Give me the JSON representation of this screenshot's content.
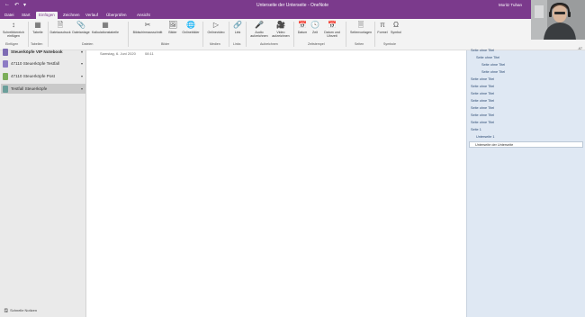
{
  "titlebar": {
    "title": "Unterseite der Unterseite  -  OneNote",
    "user": "Moritz Tuhan",
    "color": "#7b3a8c"
  },
  "menu": [
    "Datei",
    "Start",
    "Einfügen",
    "Zeichnen",
    "Verlauf",
    "Überprüfen",
    "Ansicht"
  ],
  "menu_active": "Einfügen",
  "ribbon": {
    "buttons": {
      "space": "Schreibbereich einfügen",
      "table": "Tabelle",
      "printout": "Dateiausdruck",
      "attachment": "Dateianlage",
      "spreadsheet": "Kalkulationstabelle",
      "screenshot": "Bildschirmausschnitt",
      "pictures": "Bilder",
      "online_pictures": "Onlinebilder",
      "online_video": "Onlinevideo",
      "link": "Link",
      "audio": "Audio aufzeichnen",
      "video": "Video aufzeichnen",
      "date": "Datum",
      "time": "Zeit",
      "datetime": "Datum und Uhrzeit",
      "page_templates": "Seitenvorlagen",
      "formula": "Formel",
      "symbol": "Symbol"
    },
    "groups": {
      "insert": "Einfügen",
      "tables": "Tabellen",
      "files": "Dateien",
      "images": "Bilder",
      "media": "Medien",
      "links": "Links",
      "recording": "Aufzeichnen",
      "timestamp": "Zeitstempel",
      "pages": "Seiten",
      "symbols": "Symbole"
    }
  },
  "notebooks": [
    {
      "label": "Steuerköpfe VIP Notebook",
      "color": "#7d6bb3"
    },
    {
      "label": "47110 Steuerköpfe Testfall",
      "color": "#8d7bc4"
    },
    {
      "label": "47110 Steuerköpfe Post",
      "color": "#7cae5a"
    },
    {
      "label": "Testfall Steuerköpfe",
      "color": "#6a9e9a"
    }
  ],
  "quick_notes": "Schnelle Notizen",
  "page": {
    "date": "Samstag, 6. Juni 2020",
    "time": "08:11"
  },
  "pages": [
    "Seite ohne Titel",
    "Seite ohne Titel",
    "Seite ohne Titel",
    "Seite ohne Titel",
    "Seite ohne Titel",
    "Seite ohne Titel",
    "Seite ohne Titel",
    "Seite ohne Titel",
    "Seite ohne Titel",
    "Seite ohne Titel",
    "Seite ohne Titel",
    "Seite 1",
    "Unterseite 1",
    "Unterseite der Unterseite"
  ],
  "zoom": "-67"
}
